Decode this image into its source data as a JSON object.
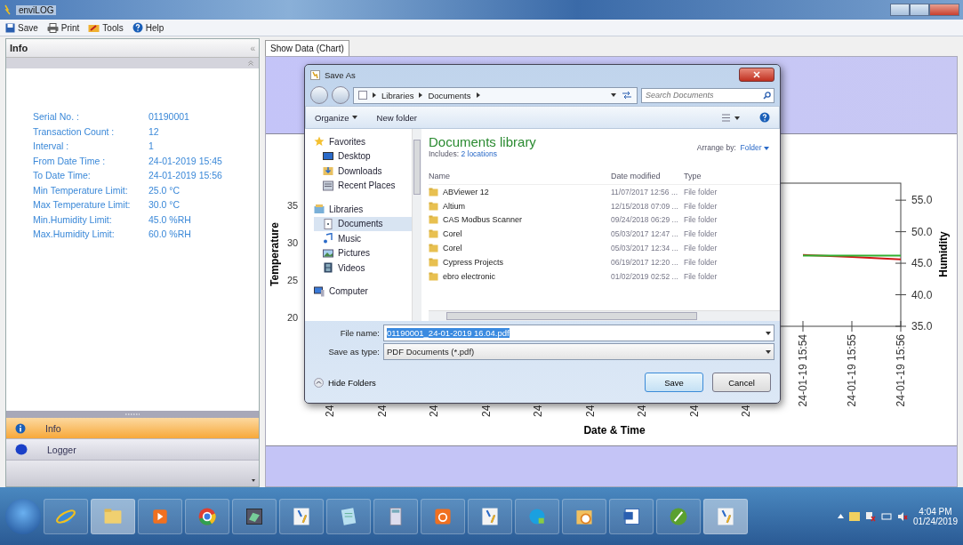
{
  "window": {
    "title": "enviLOG"
  },
  "toolbar": [
    {
      "label": "Save",
      "kind": "save"
    },
    {
      "label": "Print",
      "kind": "print"
    },
    {
      "label": "Tools",
      "kind": "tools"
    },
    {
      "label": "Help",
      "kind": "help"
    }
  ],
  "info_panel": {
    "title": "Info",
    "collapse": "«",
    "rows": [
      {
        "label": "Serial No. :",
        "value": "01190001"
      },
      {
        "label": "Transaction Count :",
        "value": "12"
      },
      {
        "label": "Interval :",
        "value": "1"
      },
      {
        "label": "From Date Time :",
        "value": "24-01-2019  15:45"
      },
      {
        "label": "To Date Time:",
        "value": "24-01-2019  15:56"
      },
      {
        "label": "Min Temperature Limit:",
        "value": "25.0  °C"
      },
      {
        "label": "Max Temperature Limit:",
        "value": "30.0  °C"
      },
      {
        "label": "Min.Humidity Limit:",
        "value": "45.0  %RH"
      },
      {
        "label": "Max.Humidity Limit:",
        "value": "60.0  %RH"
      }
    ],
    "nav": [
      {
        "label": "Info",
        "kind": "info",
        "selected": true
      },
      {
        "label": "Logger",
        "kind": "disk",
        "selected": false
      }
    ]
  },
  "tabs": [
    {
      "label": "Show Data (Chart)",
      "selected": true
    }
  ],
  "chart": {
    "temperature_axis": {
      "label": "Temperature",
      "ticks": [
        "35",
        "30",
        "25",
        "20"
      ]
    },
    "x_label_fragments": [
      "24",
      "24",
      "24",
      "24",
      "24",
      "24",
      "24",
      "24",
      "24"
    ],
    "chart_data": {
      "type": "line",
      "ylabel": "Humidity",
      "annotations": [
        {
          "text": "Date & Time"
        }
      ],
      "categories": [
        "24-01-19 15:54",
        "24-01-19 15:55",
        "24-01-19 15:56"
      ],
      "ylim": [
        35,
        57.7
      ],
      "yticks": [
        {
          "value": 35,
          "label": "35.0"
        },
        {
          "value": 40,
          "label": "40.0"
        },
        {
          "value": 45,
          "label": "45.0"
        },
        {
          "value": 50,
          "label": "50.0"
        },
        {
          "value": 55,
          "label": "55.0"
        }
      ],
      "series": [
        {
          "color": "#d01818",
          "values": [
            46.3,
            46.0,
            45.6
          ]
        },
        {
          "color": "#30b030",
          "values": [
            46.2,
            46.2,
            46.2
          ]
        }
      ]
    }
  },
  "dialog": {
    "title": "Save As",
    "breadcrumb": [
      "Libraries",
      "Documents"
    ],
    "search": {
      "placeholder": "Search Documents"
    },
    "commands": [
      "Organize",
      "New folder"
    ],
    "library_title": "Documents library",
    "includes_label": "Includes:",
    "includes_link": "2 locations",
    "arrange_label": "Arrange by:",
    "arrange_value": "Folder",
    "nav": [
      {
        "label": "Favorites",
        "kind": "star",
        "group": true,
        "selected": false
      },
      {
        "label": "Desktop",
        "kind": "monitor",
        "group": false,
        "selected": false
      },
      {
        "label": "Downloads",
        "kind": "download",
        "group": false,
        "selected": false
      },
      {
        "label": "Recent Places",
        "kind": "places",
        "group": false,
        "selected": false
      },
      {
        "label": "Libraries",
        "kind": "library",
        "group": true,
        "selected": false
      },
      {
        "label": "Documents",
        "kind": "document",
        "group": false,
        "selected": true
      },
      {
        "label": "Music",
        "kind": "music",
        "group": false,
        "selected": false
      },
      {
        "label": "Pictures",
        "kind": "picture",
        "group": false,
        "selected": false
      },
      {
        "label": "Videos",
        "kind": "video",
        "group": false,
        "selected": false
      },
      {
        "label": "Computer",
        "kind": "computer",
        "group": true,
        "selected": false
      }
    ],
    "columns": [
      "Name",
      "Date modified",
      "Type"
    ],
    "files": [
      {
        "name": "ABViewer 12",
        "date": "11/07/2017 12:56 ...",
        "type": "File folder"
      },
      {
        "name": "Altium",
        "date": "12/15/2018 07:09 ...",
        "type": "File folder"
      },
      {
        "name": "CAS Modbus Scanner",
        "date": "09/24/2018 06:29 ...",
        "type": "File folder"
      },
      {
        "name": "Corel",
        "date": "05/03/2017 12:47 ...",
        "type": "File folder"
      },
      {
        "name": "Corel",
        "date": "05/03/2017 12:34 ...",
        "type": "File folder"
      },
      {
        "name": "Cypress Projects",
        "date": "06/19/2017 12:20 ...",
        "type": "File folder"
      },
      {
        "name": "ebro electronic",
        "date": "01/02/2019 02:52 ...",
        "type": "File folder"
      }
    ],
    "file_name_label": "File name:",
    "file_name": "01190001_24-01-2019 16.04.pdf",
    "type_label": "Save as type:",
    "type_value": "PDF Documents (*.pdf)",
    "hide_folders": "Hide Folders",
    "buttons": [
      "Save",
      "Cancel"
    ]
  },
  "taskbar": {
    "apps": [
      {
        "kind": "globe",
        "active": false
      },
      {
        "kind": "folder",
        "active": true
      },
      {
        "kind": "play",
        "active": false
      },
      {
        "kind": "ring",
        "active": false
      },
      {
        "kind": "monitor",
        "active": false
      },
      {
        "kind": "arrow",
        "active": false
      },
      {
        "kind": "notepad",
        "active": false
      },
      {
        "kind": "calculator",
        "active": false
      },
      {
        "kind": "swirl",
        "active": false
      },
      {
        "kind": "arrow",
        "active": false
      },
      {
        "kind": "chat",
        "active": false
      },
      {
        "kind": "clock",
        "active": false
      },
      {
        "kind": "word",
        "active": false
      },
      {
        "kind": "pen",
        "active": false
      },
      {
        "kind": "arrow",
        "active": true
      }
    ],
    "time": "4:04 PM",
    "date": "01/24/2019"
  }
}
